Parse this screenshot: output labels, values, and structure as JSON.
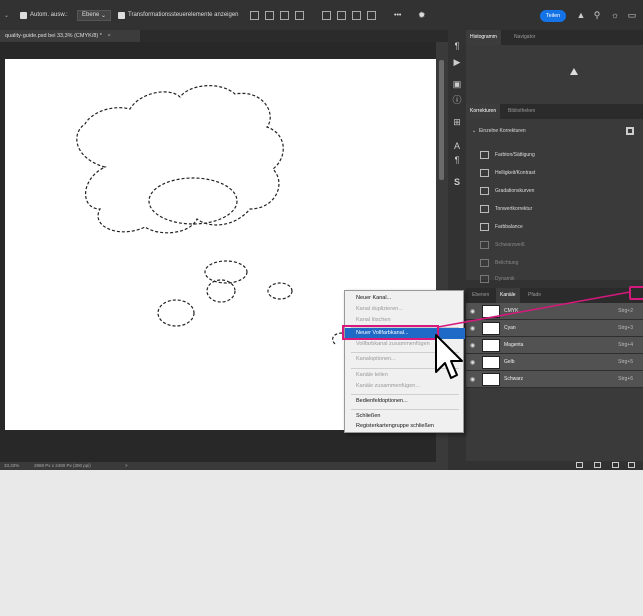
{
  "options_bar": {
    "auto_select_label": "Autom. ausw.:",
    "auto_select_value": "Ebene",
    "transform_label": "Transformationssteuerelemente anzeigen",
    "more_label": "•••",
    "share_label": "Teilen"
  },
  "document_tab": {
    "title": "quality-guide.psd bei 33,3% (CMYK/8) *",
    "close": "×"
  },
  "status_bar": {
    "zoom": "33,33%",
    "doc_info": "2868 Px x 2480 Px (300 ppi)",
    "arrow": ">"
  },
  "tools": [
    "¶",
    "▶",
    "▣",
    "ⓘ",
    "⊞",
    "A",
    "¶",
    "S"
  ],
  "history_panel": {
    "tabs": [
      "Histogramm",
      "Navigator"
    ]
  },
  "adjustments_panel": {
    "tabs": [
      "Korrekturen",
      "Bibliotheken"
    ],
    "header": "Einzelne Korrekturen",
    "items": [
      {
        "label": "Farbton/Sättigung",
        "enabled": true
      },
      {
        "label": "Helligkeit/Kontrast",
        "enabled": true
      },
      {
        "label": "Gradationskurven",
        "enabled": true
      },
      {
        "label": "Tonwertkorrektur",
        "enabled": true
      },
      {
        "label": "Farbbalance",
        "enabled": true
      },
      {
        "label": "Schwarzweiß",
        "enabled": false
      },
      {
        "label": "Belichtung",
        "enabled": false
      },
      {
        "label": "Dynamik",
        "enabled": false
      }
    ]
  },
  "channels_panel": {
    "tabs": [
      "Ebenen",
      "Kanäle",
      "Pfade"
    ],
    "channels": [
      {
        "name": "CMYK",
        "shortcut": "Strg+2"
      },
      {
        "name": "Cyan",
        "shortcut": "Strg+3"
      },
      {
        "name": "Magenta",
        "shortcut": "Strg+4"
      },
      {
        "name": "Gelb",
        "shortcut": "Strg+5"
      },
      {
        "name": "Schwarz",
        "shortcut": "Strg+6"
      }
    ]
  },
  "context_menu": {
    "items": [
      {
        "label": "Neuer Kanal...",
        "enabled": true
      },
      {
        "label": "Kanal duplizieren...",
        "enabled": false
      },
      {
        "label": "Kanal löschen",
        "enabled": false
      },
      {
        "label": "Neuer Vollfarbkanal...",
        "enabled": true,
        "highlighted": true
      },
      {
        "label": "Vollfarbkanal zusammenfügen",
        "enabled": false
      },
      {
        "label": "Kanaloptionen...",
        "enabled": false
      },
      {
        "label": "Kanäle teilen",
        "enabled": false
      },
      {
        "label": "Kanäle zusammenfügen...",
        "enabled": false
      },
      {
        "label": "Bedienfeldoptionen...",
        "enabled": true
      },
      {
        "label": "Schließen",
        "enabled": true
      },
      {
        "label": "Registerkartengruppe schließen",
        "enabled": true
      }
    ]
  },
  "colors": {
    "highlight": "#1f69c7",
    "annotation": "#d6197c",
    "share_button": "#1473e6"
  }
}
